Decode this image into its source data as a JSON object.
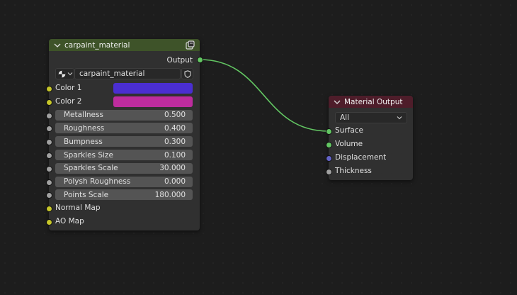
{
  "colors": {
    "group_header": "#3e5329",
    "output_header": "#4e1d2a",
    "socket_float": "#a1a1a1",
    "socket_color": "#c7c729",
    "socket_shader": "#63c763",
    "socket_vector": "#6363c7",
    "link": "#63c763"
  },
  "group_node": {
    "title": "carpaint_material",
    "output_label": "Output",
    "material_name": "carpaint_material",
    "inputs": [
      {
        "label": "Color 1",
        "type": "color",
        "value": "#4a2ed1"
      },
      {
        "label": "Color 2",
        "type": "color",
        "value": "#bd2c9e"
      },
      {
        "label": "Metallness",
        "type": "float",
        "value": "0.500"
      },
      {
        "label": "Roughness",
        "type": "float",
        "value": "0.400"
      },
      {
        "label": "Bumpness",
        "type": "float",
        "value": "0.300"
      },
      {
        "label": "Sparkles Size",
        "type": "float",
        "value": "0.100"
      },
      {
        "label": "Sparkles Scale",
        "type": "float",
        "value": "30.000"
      },
      {
        "label": "Polysh Roughness",
        "type": "float",
        "value": "0.000"
      },
      {
        "label": "Points Scale",
        "type": "float",
        "value": "180.000"
      },
      {
        "label": "Normal Map",
        "type": "socket"
      },
      {
        "label": "AO Map",
        "type": "socket"
      }
    ]
  },
  "material_output": {
    "title": "Material Output",
    "target": "All",
    "inputs": [
      {
        "label": "Surface",
        "socket": "shader"
      },
      {
        "label": "Volume",
        "socket": "shader"
      },
      {
        "label": "Displacement",
        "socket": "vector"
      },
      {
        "label": "Thickness",
        "socket": "float"
      }
    ]
  }
}
